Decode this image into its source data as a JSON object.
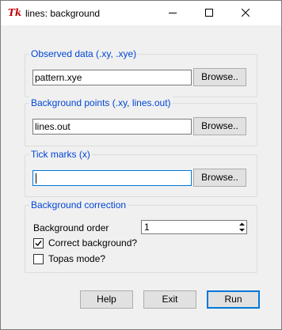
{
  "window": {
    "title": "lines: background",
    "icon": "Tk"
  },
  "observed": {
    "label": "Observed data (.xy, .xye)",
    "value": "pattern.xye",
    "browse_label": "Browse.."
  },
  "background_points": {
    "label": "Background points (.xy, lines.out)",
    "value": "lines.out",
    "browse_label": "Browse.."
  },
  "ticks": {
    "label": "Tick marks (x)",
    "value": "",
    "browse_label": "Browse.."
  },
  "correction": {
    "label": "Background correction",
    "order_label": "Background order",
    "order_value": "1",
    "correct_label": "Correct background?",
    "correct_checked": true,
    "topas_label": "Topas mode?",
    "topas_checked": false
  },
  "buttons": {
    "help": "Help",
    "exit": "Exit",
    "run": "Run"
  },
  "colors": {
    "group_label": "#0046d5",
    "focus": "#0078d7",
    "icon_red": "#c00000"
  }
}
